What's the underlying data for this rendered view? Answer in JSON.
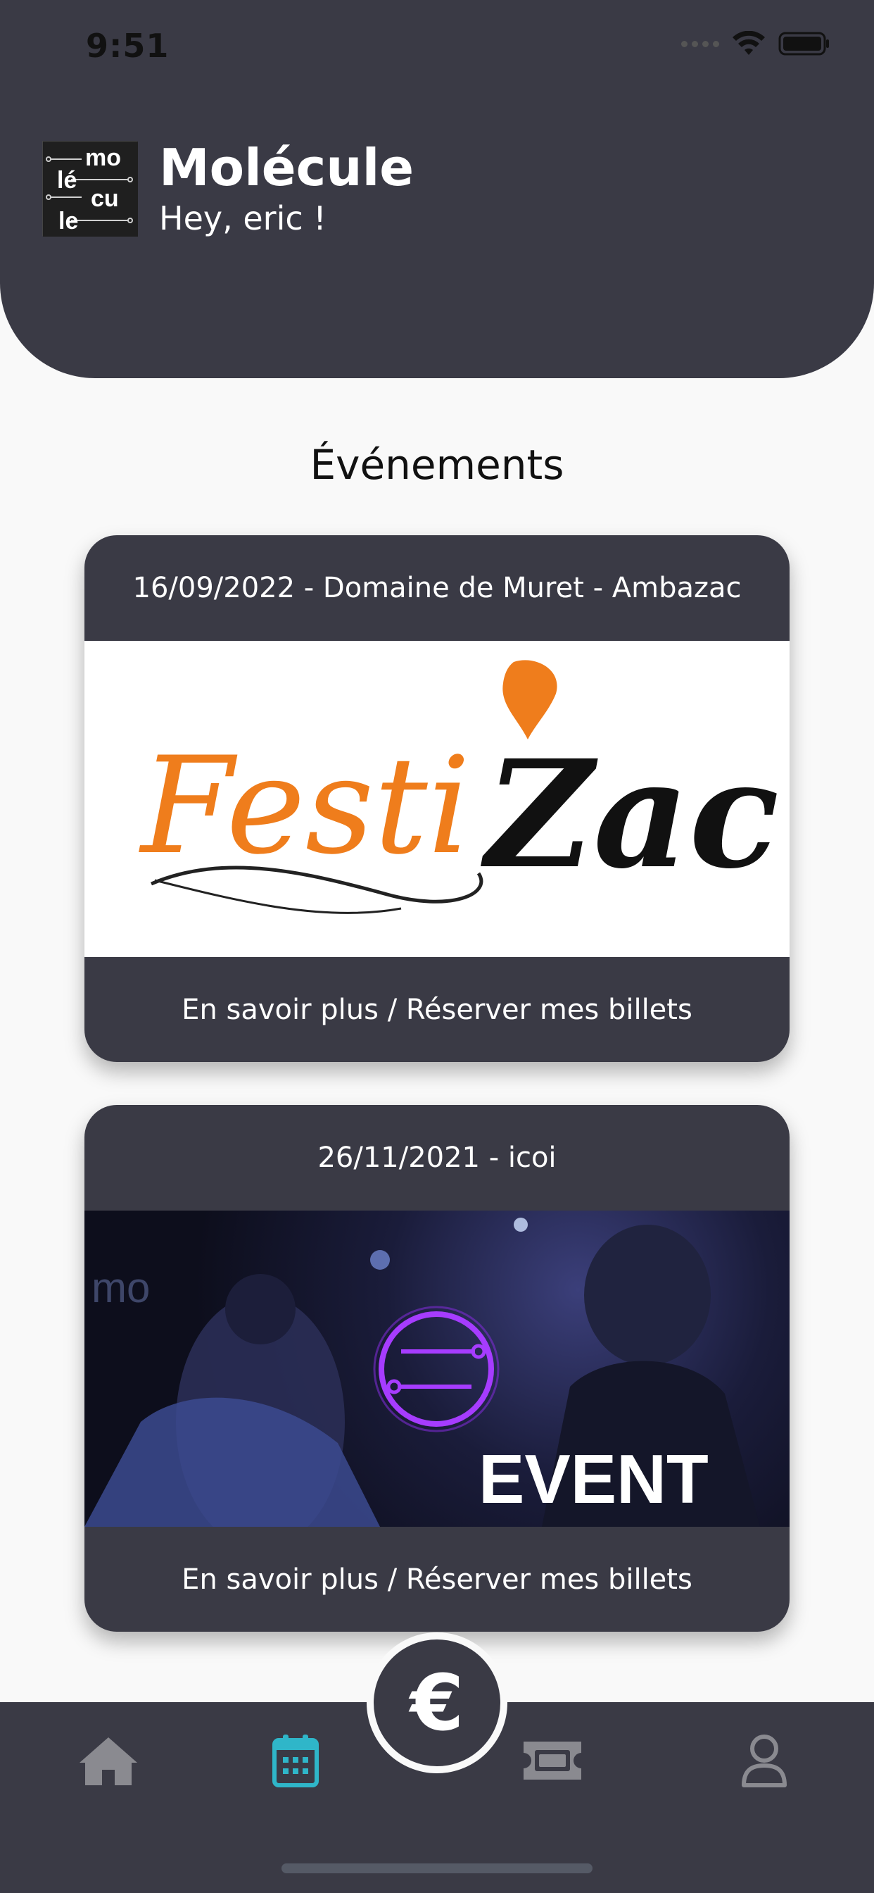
{
  "status_bar": {
    "time": "9:51"
  },
  "header": {
    "logo_lines": [
      "mo",
      "lé",
      "cu",
      "le"
    ],
    "title": "Molécule",
    "greeting": "Hey, eric !"
  },
  "section_title": "Événements",
  "events": [
    {
      "header": "16/09/2022 - Domaine de Muret - Ambazac",
      "image_text_a": "Festi",
      "image_text_b": "Zac",
      "cta": "En savoir plus / Réserver mes billets"
    },
    {
      "header": "26/11/2021 - icoi",
      "image_text": "EVENT",
      "image_bg_text": "mo",
      "cta": "En savoir plus / Réserver mes billets"
    }
  ],
  "bottom_nav": {
    "fab_symbol": "€",
    "items": [
      "home-icon",
      "calendar-icon",
      "ticket-icon",
      "user-icon"
    ],
    "active": "calendar-icon",
    "active_color": "#2fb6c9",
    "inactive_color": "#8a8a90"
  },
  "colors": {
    "primary_dark": "#3a3a45",
    "background": "#f9f9f9",
    "festi_orange": "#ef7d1c"
  }
}
